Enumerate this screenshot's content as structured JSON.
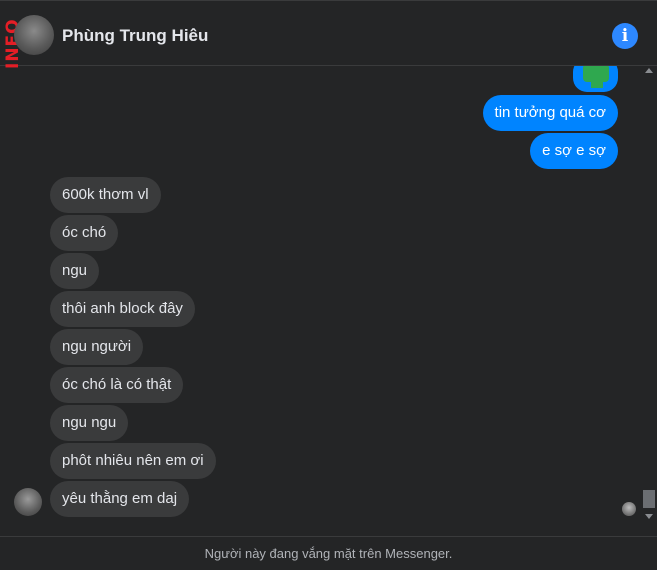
{
  "watermark": "INFO",
  "header": {
    "contact_name": "Phùng Trung Hiêu",
    "info_icon": "info-icon"
  },
  "messages": [
    {
      "dir": "out",
      "text": "tin tưởng quá cơ"
    },
    {
      "dir": "out",
      "text": "e sợ e sợ"
    },
    {
      "dir": "in",
      "text": "600k thơm vl"
    },
    {
      "dir": "in",
      "text": "óc chó"
    },
    {
      "dir": "in",
      "text": "ngu"
    },
    {
      "dir": "in",
      "text": "thôi anh block đây"
    },
    {
      "dir": "in",
      "text": "ngu người"
    },
    {
      "dir": "in",
      "text": "óc chó là có thật"
    },
    {
      "dir": "in",
      "text": "ngu ngu"
    },
    {
      "dir": "in",
      "text": "phôt nhiêu nên em ơi"
    },
    {
      "dir": "in",
      "text": "yêu thằng em daj"
    }
  ],
  "footer": {
    "status": "Người này đang vắng mặt trên Messenger."
  },
  "colors": {
    "background": "#242526",
    "outgoing_bubble": "#0084ff",
    "incoming_bubble": "#3a3b3c",
    "accent": "#2d88ff",
    "watermark": "#e41e26"
  }
}
